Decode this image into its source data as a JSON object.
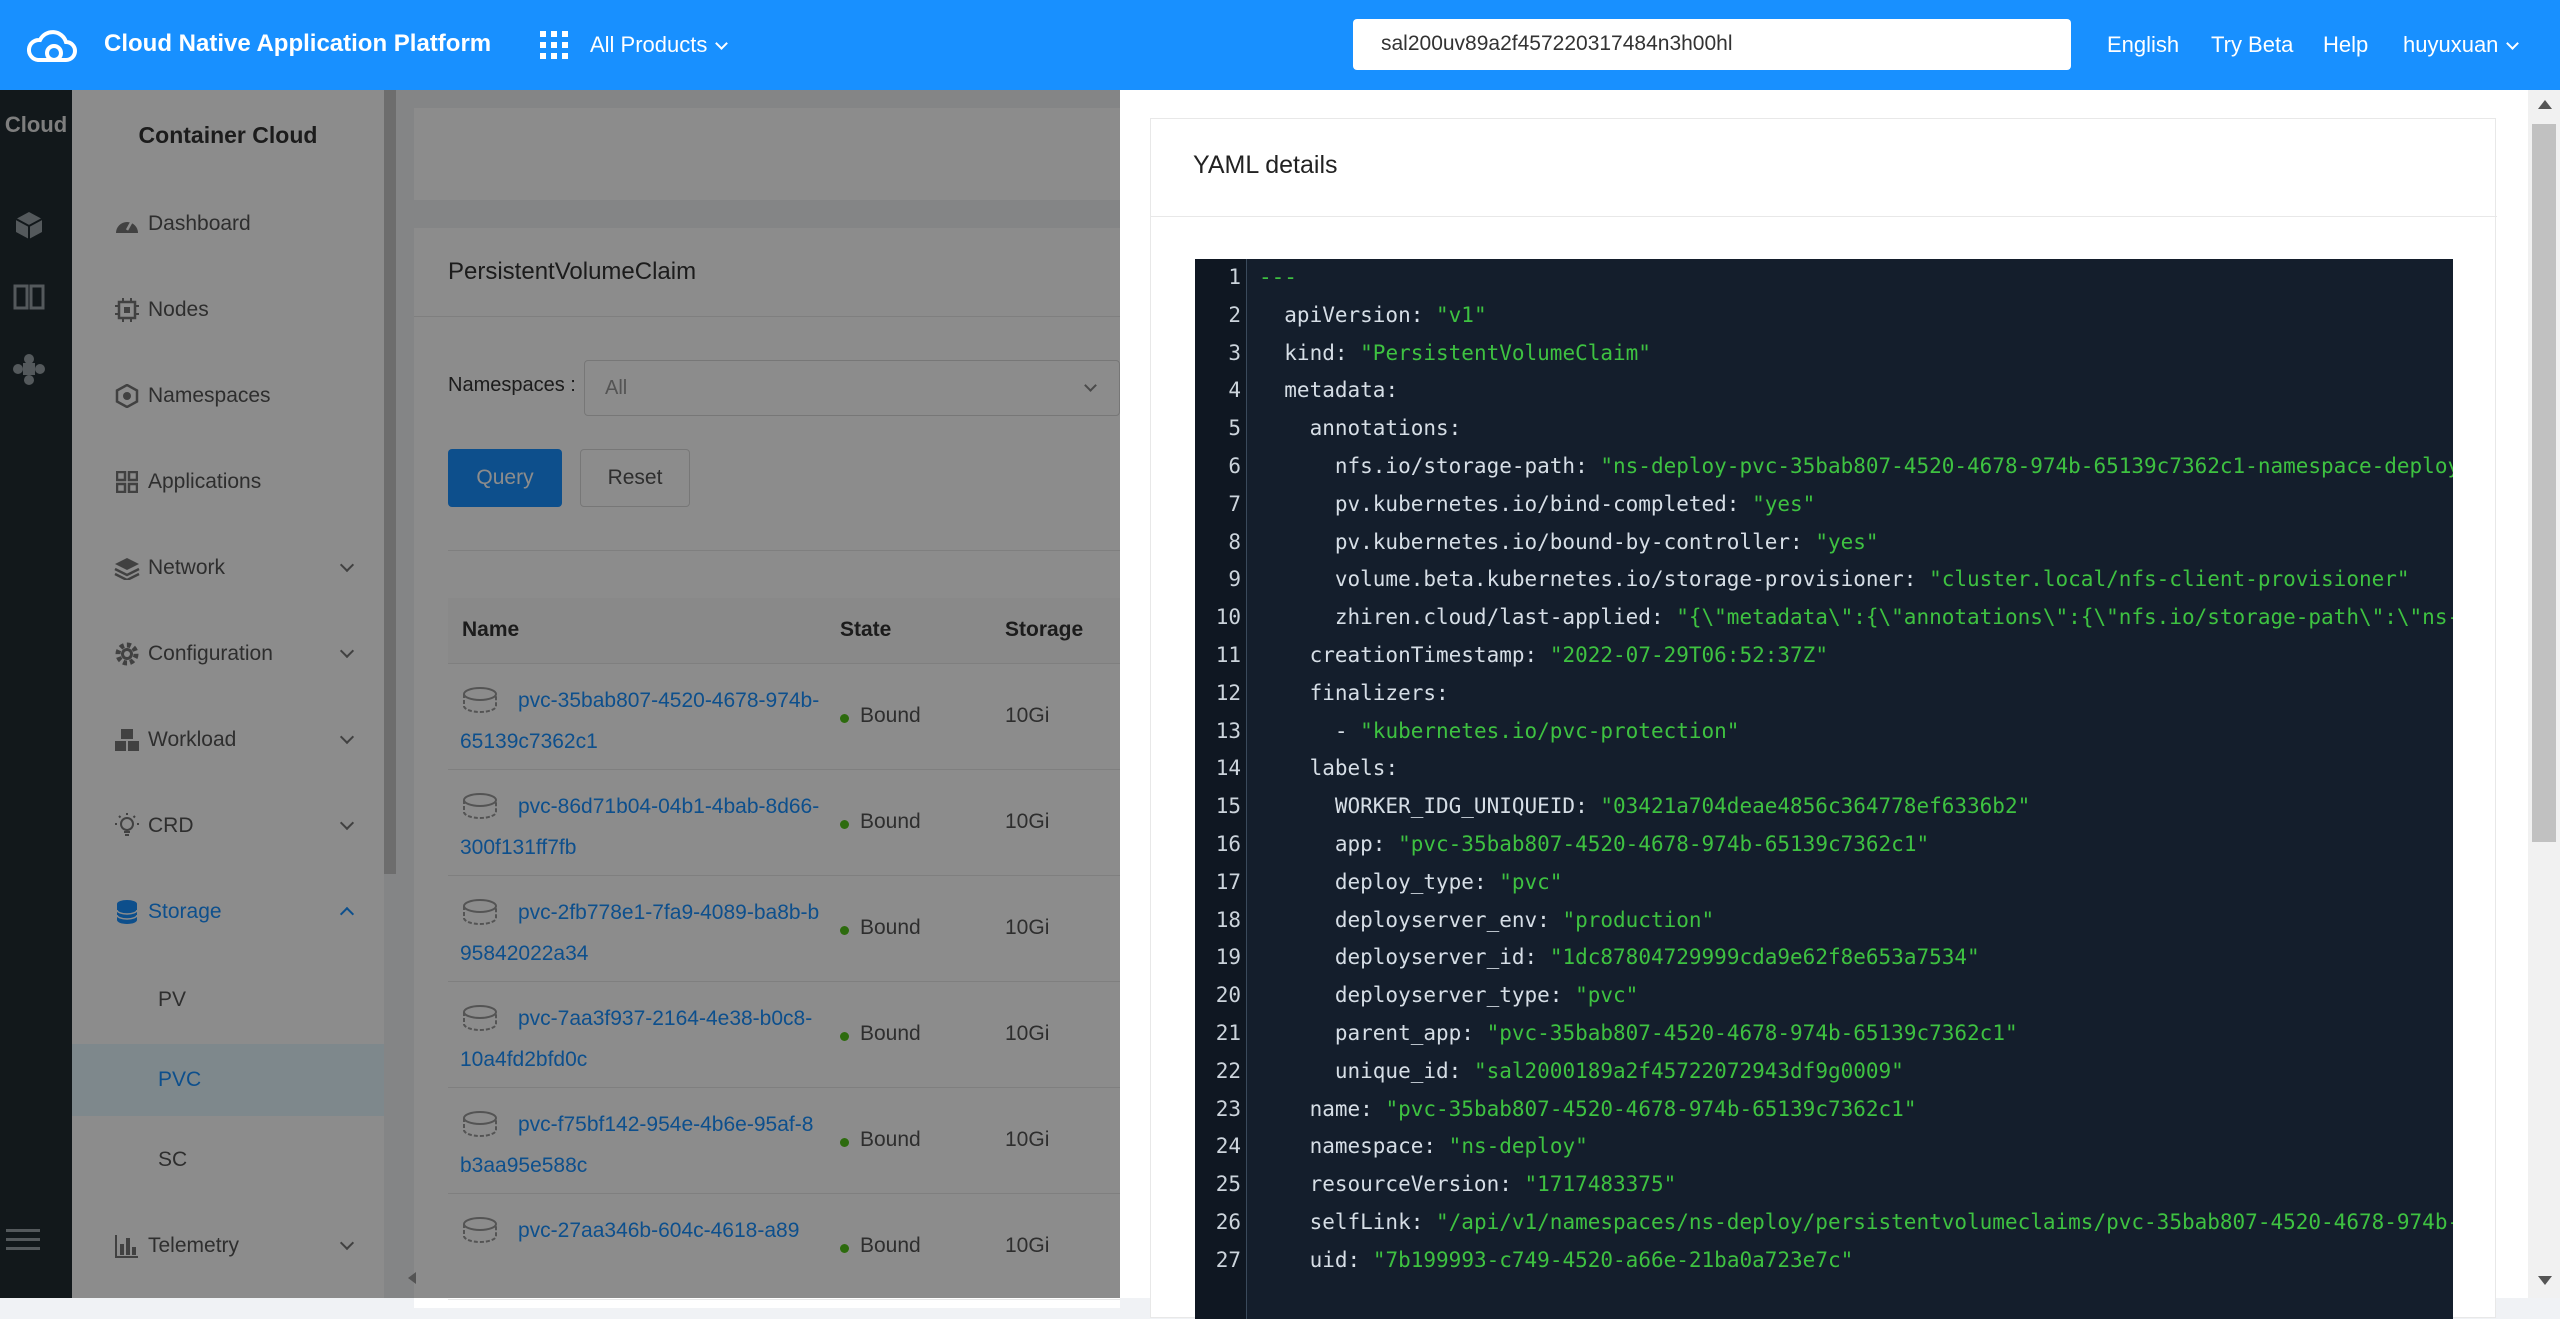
{
  "header": {
    "app_title": "Cloud Native Application Platform",
    "all_products": "All Products",
    "search_value": "sal200uv89a2f457220317484n3h00hl",
    "nav": [
      "English",
      "Try Beta",
      "Help",
      "huyuxuan"
    ]
  },
  "rail": {
    "title": "Cloud"
  },
  "sidebar": {
    "title": "Container Cloud",
    "items": [
      "Dashboard",
      "Nodes",
      "Namespaces",
      "Applications",
      "Network",
      "Configuration",
      "Workload",
      "CRD",
      "Storage"
    ],
    "storage_sub": [
      "PV",
      "PVC",
      "SC"
    ],
    "telemetry": "Telemetry"
  },
  "main": {
    "card_title": "PersistentVolumeClaim",
    "namespaces_label": "Namespaces :",
    "namespaces_value": "All",
    "query_button": "Query",
    "reset_button": "Reset",
    "columns": [
      "Name",
      "State",
      "Storage"
    ],
    "rows": [
      {
        "name": "pvc-35bab807-4520-4678-974b-65139c7362c1",
        "state": "Bound",
        "storage": "10Gi"
      },
      {
        "name": "pvc-86d71b04-04b1-4bab-8d66-300f131ff7fb",
        "state": "Bound",
        "storage": "10Gi"
      },
      {
        "name": "pvc-2fb778e1-7fa9-4089-ba8b-b95842022a34",
        "state": "Bound",
        "storage": "10Gi"
      },
      {
        "name": "pvc-7aa3f937-2164-4e38-b0c8-10a4fd2bfd0c",
        "state": "Bound",
        "storage": "10Gi"
      },
      {
        "name": "pvc-f75bf142-954e-4b6e-95af-8b3aa95e588c",
        "state": "Bound",
        "storage": "10Gi"
      },
      {
        "name": "pvc-27aa346b-604c-4618-a89",
        "state": "Bound",
        "storage": "10Gi"
      }
    ]
  },
  "drawer": {
    "title": "YAML details",
    "lines": [
      [
        "---",
        ""
      ],
      [
        "  apiVersion",
        "\"v1\""
      ],
      [
        "  kind",
        "\"PersistentVolumeClaim\""
      ],
      [
        "  metadata",
        ""
      ],
      [
        "    annotations",
        ""
      ],
      [
        "      nfs.io/storage-path",
        "\"ns-deploy-pvc-35bab807-4520-4678-974b-65139c7362c1-namespace-deploy"
      ],
      [
        "      pv.kubernetes.io/bind-completed",
        "\"yes\""
      ],
      [
        "      pv.kubernetes.io/bound-by-controller",
        "\"yes\""
      ],
      [
        "      volume.beta.kubernetes.io/storage-provisioner",
        "\"cluster.local/nfs-client-provisioner\""
      ],
      [
        "      zhiren.cloud/last-applied",
        "\"{\\\"metadata\\\":{\\\"annotations\\\":{\\\"nfs.io/storage-path\\\":\\\"ns-"
      ],
      [
        "    creationTimestamp",
        "\"2022-07-29T06:52:37Z\""
      ],
      [
        "    finalizers",
        ""
      ],
      [
        "      - ",
        "\"kubernetes.io/pvc-protection\""
      ],
      [
        "    labels",
        ""
      ],
      [
        "      WORKER_IDG_UNIQUEID",
        "\"03421a704deae4856c364778ef6336b2\""
      ],
      [
        "      app",
        "\"pvc-35bab807-4520-4678-974b-65139c7362c1\""
      ],
      [
        "      deploy_type",
        "\"pvc\""
      ],
      [
        "      deployserver_env",
        "\"production\""
      ],
      [
        "      deployserver_id",
        "\"1dc87804729999cda9e62f8e653a7534\""
      ],
      [
        "      deployserver_type",
        "\"pvc\""
      ],
      [
        "      parent_app",
        "\"pvc-35bab807-4520-4678-974b-65139c7362c1\""
      ],
      [
        "      unique_id",
        "\"sal2000189a2f45722072943df9g0009\""
      ],
      [
        "    name",
        "\"pvc-35bab807-4520-4678-974b-65139c7362c1\""
      ],
      [
        "    namespace",
        "\"ns-deploy\""
      ],
      [
        "    resourceVersion",
        "\"1717483375\""
      ],
      [
        "    selfLink",
        "\"/api/v1/namespaces/ns-deploy/persistentvolumeclaims/pvc-35bab807-4520-4678-974b-"
      ],
      [
        "    uid",
        "\"7b199993-c749-4520-a66e-21ba0a723e7c\""
      ]
    ]
  },
  "colors": {
    "primary": "#1890ff",
    "rail_bg": "#222d32",
    "code_bg": "#141e2c",
    "string": "#3ec241",
    "status_ok": "#52c41a"
  }
}
